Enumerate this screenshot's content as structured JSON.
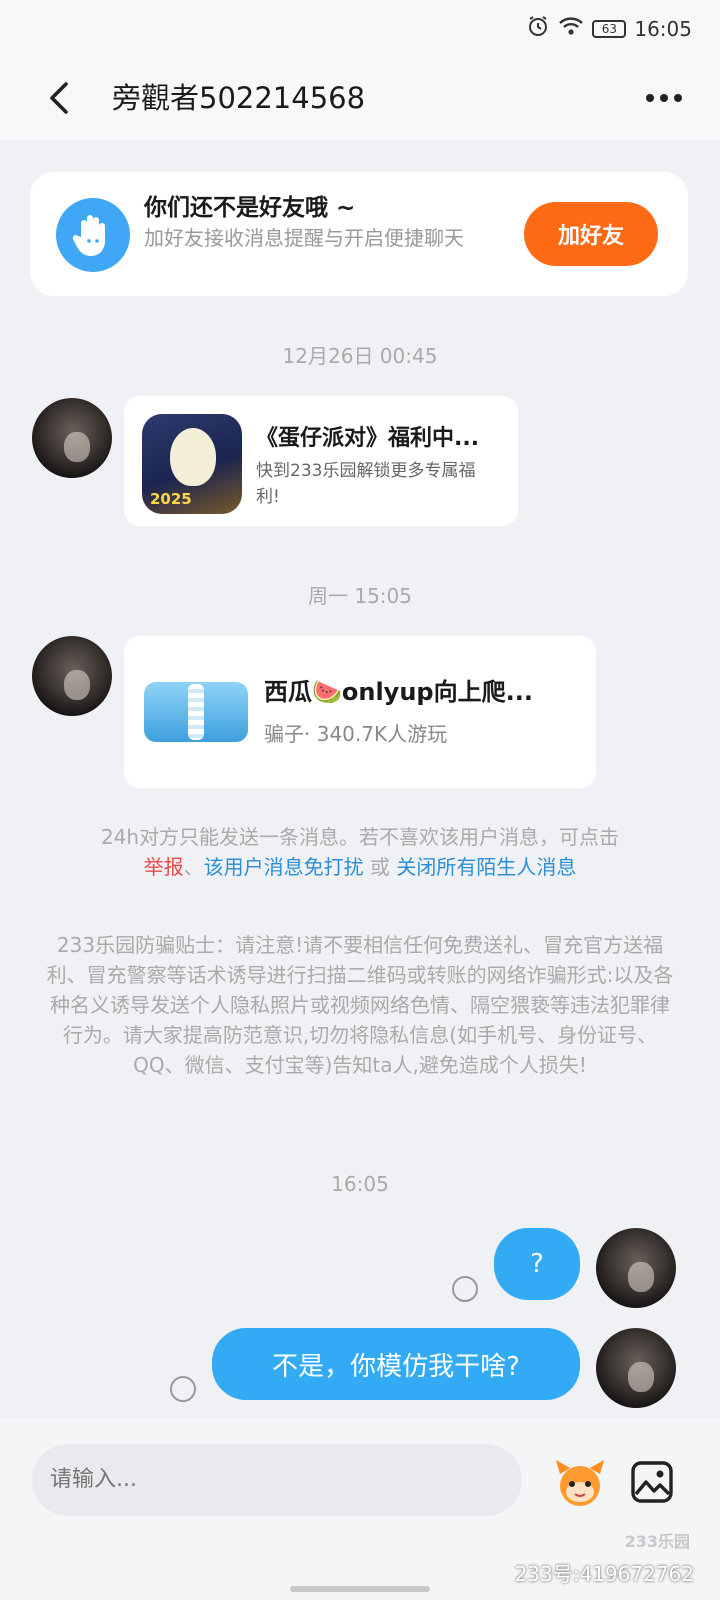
{
  "status_bar": {
    "battery": "63",
    "time": "16:05"
  },
  "header": {
    "title": "旁觀者502214568"
  },
  "friend_prompt": {
    "title": "你们还不是好友哦 ~",
    "subtitle": "加好友接收消息提醒与开启便捷聊天",
    "button": "加好友"
  },
  "messages": {
    "ts1": "12月26日 00:45",
    "card1": {
      "title": "《蛋仔派对》福利中...",
      "desc": "快到233乐园解锁更多专属福利!",
      "icon_text": "2025"
    },
    "ts2": "周一 15:05",
    "card2": {
      "title": "西瓜🍉onlyup向上爬...",
      "subtitle": "骗子· 340.7K人游玩"
    },
    "notice": {
      "prefix": "24h对方只能发送一条消息。若不喜欢该用户消息，可点击",
      "report": "举报",
      "sep": "、",
      "mute": "该用户消息免打扰",
      "or": " 或 ",
      "close_all": "关闭所有陌生人消息"
    },
    "warning": "233乐园防骗贴士：请注意!请不要相信任何免费送礼、冒充官方送福利、冒充警察等话术诱导进行扫描二维码或转账的网络诈骗形式:以及各种名义诱导发送个人隐私照片或视频网络色情、隔空猥亵等违法犯罪律行为。请大家提高防范意识,切勿将隐私信息(如手机号、身份证号、QQ、微信、支付宝等)告知ta人,避免造成个人损失!",
    "ts3": "16:05",
    "sent1": "?",
    "sent2": "不是，你模仿我干啥?"
  },
  "input": {
    "placeholder": "请输入..."
  },
  "watermark": {
    "logo": "233乐园",
    "id": "233号:419672762"
  },
  "colors": {
    "accent_blue": "#33aaf4",
    "add_orange": "#ff6a14",
    "report_red": "#e84a4a",
    "link_blue": "#2c8fd6"
  }
}
